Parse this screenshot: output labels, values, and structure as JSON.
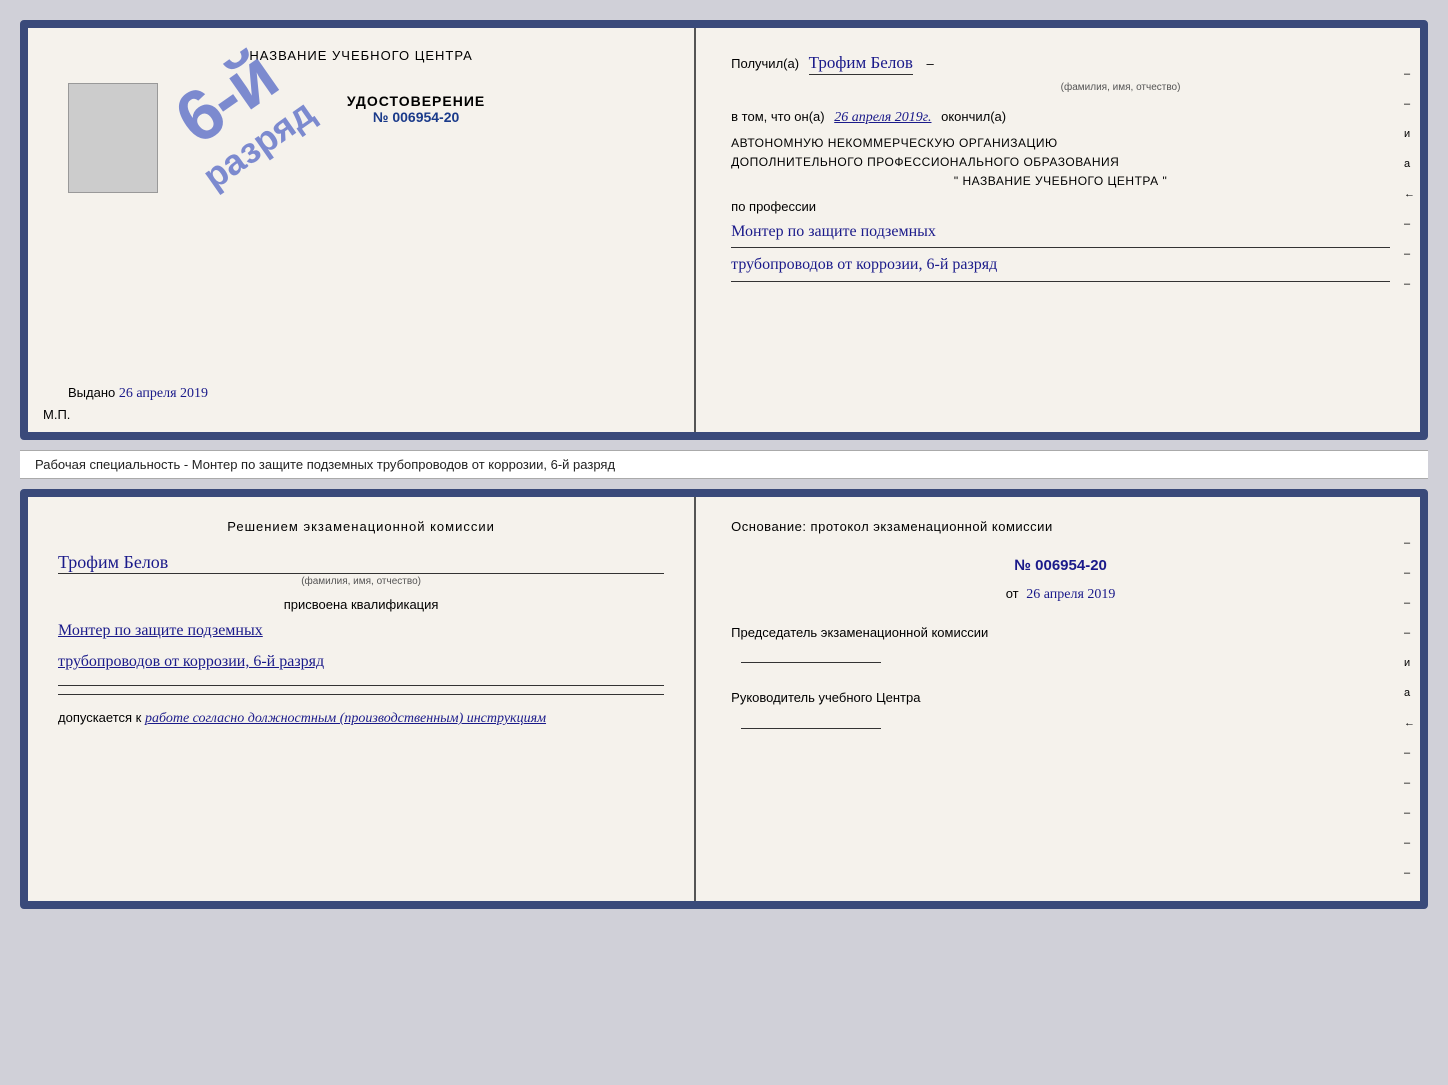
{
  "top_cert": {
    "left": {
      "school_name": "НАЗВАНИЕ УЧЕБНОГО ЦЕНТРА",
      "stamp_line1": "6-й",
      "stamp_line2": "разряд",
      "udostoverenie_title": "УДОСТОВЕРЕНИЕ",
      "cert_number": "№ 006954-20",
      "vydano_label": "Выдано",
      "vydano_date": "26 апреля 2019",
      "mp_label": "М.П."
    },
    "right": {
      "poluchil_label": "Получил(а)",
      "recipient_name": "Трофим Белов",
      "fio_label": "(фамилия, имя, отчество)",
      "vtom_prefix": "в том, что он(а)",
      "date_handwritten": "26 апреля 2019г.",
      "okonchil_label": "окончил(а)",
      "org_line1": "АВТОНОМНУЮ НЕКОММЕРЧЕСКУЮ ОРГАНИЗАЦИЮ",
      "org_line2": "ДОПОЛНИТЕЛЬНОГО ПРОФЕССИОНАЛЬНОГО ОБРАЗОВАНИЯ",
      "org_line3": "\"  НАЗВАНИЕ УЧЕБНОГО ЦЕНТРА  \"",
      "poprofessii_label": "по профессии",
      "qual_line1": "Монтер по защите подземных",
      "qual_line2": "трубопроводов от коррозии, 6-й разряд",
      "side_letters": [
        "–",
        "–",
        "и",
        "а",
        "←",
        "–",
        "–",
        "–"
      ]
    }
  },
  "middle_label": {
    "text": "Рабочая специальность - Монтер по защите подземных трубопроводов от коррозии, 6-й разряд"
  },
  "bottom_cert": {
    "left": {
      "reshenie_header": "Решением экзаменационной комиссии",
      "recipient_name": "Трофим Белов",
      "fio_label": "(фамилия, имя, отчество)",
      "prisvoena_label": "присвоена квалификация",
      "qual_line1": "Монтер по защите подземных",
      "qual_line2": "трубопроводов от коррозии, 6-й разряд",
      "dopuskaetsya_label": "допускается к",
      "dopusk_text": "работе согласно должностным (производственным) инструкциям"
    },
    "right": {
      "osnovanie_header": "Основание: протокол экзаменационной комиссии",
      "protocol_number": "№ 006954-20",
      "ot_prefix": "от",
      "ot_date": "26 апреля 2019",
      "predsedatel_label": "Председатель экзаменационной комиссии",
      "rukovoditel_label": "Руководитель учебного Центра",
      "side_letters": [
        "–",
        "–",
        "–",
        "–",
        "и",
        "а",
        "←",
        "–",
        "–",
        "–",
        "–",
        "–"
      ]
    }
  }
}
